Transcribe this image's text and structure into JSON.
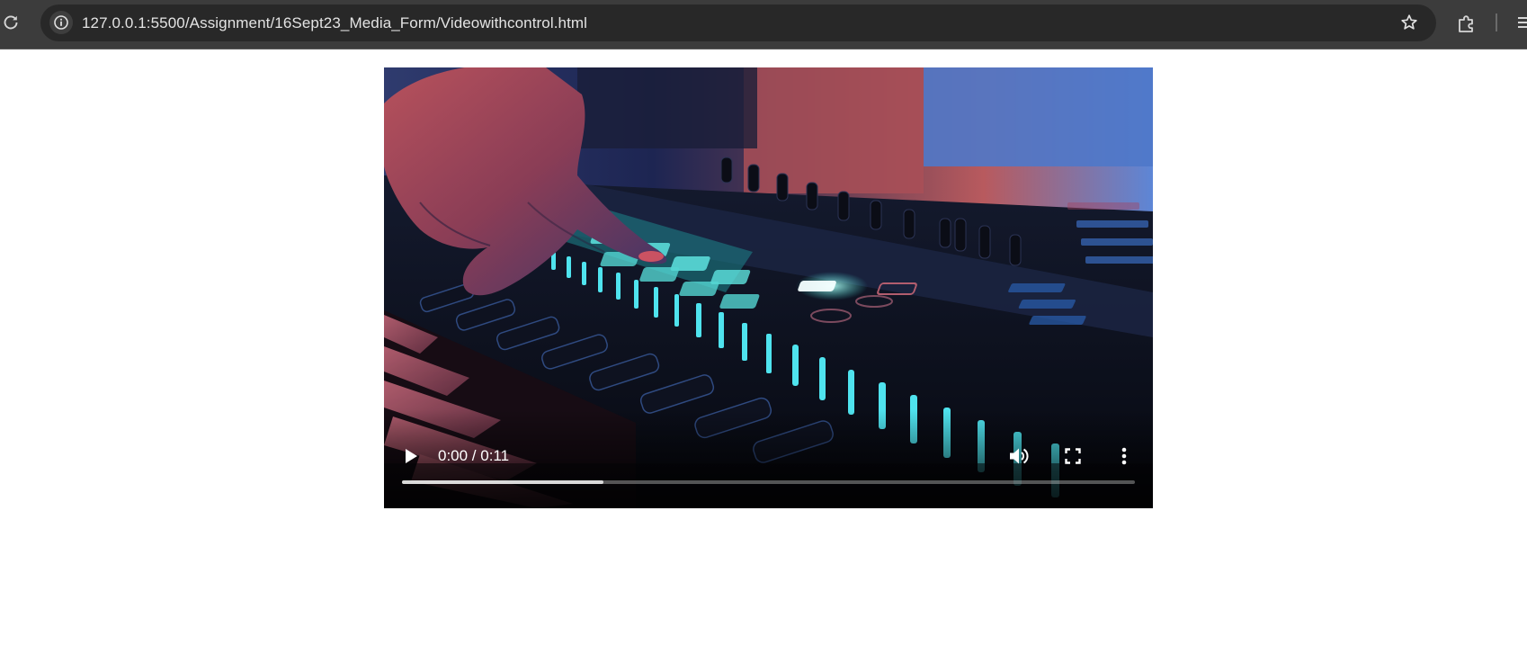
{
  "browser": {
    "url": "127.0.0.1:5500/Assignment/16Sept23_Media_Form/Videowithcontrol.html",
    "icons": {
      "reload": "reload-icon",
      "site_info": "info-icon",
      "bookmark": "star-icon",
      "extensions": "puzzle-piece-icon",
      "menu": "menu-icon"
    }
  },
  "video": {
    "time_display": "0:00 / 0:11",
    "buffered_fraction": 0.275,
    "controls": {
      "play": "play-icon",
      "volume": "volume-icon",
      "fullscreen": "fullscreen-icon",
      "more": "more-vertical-icon"
    }
  }
}
